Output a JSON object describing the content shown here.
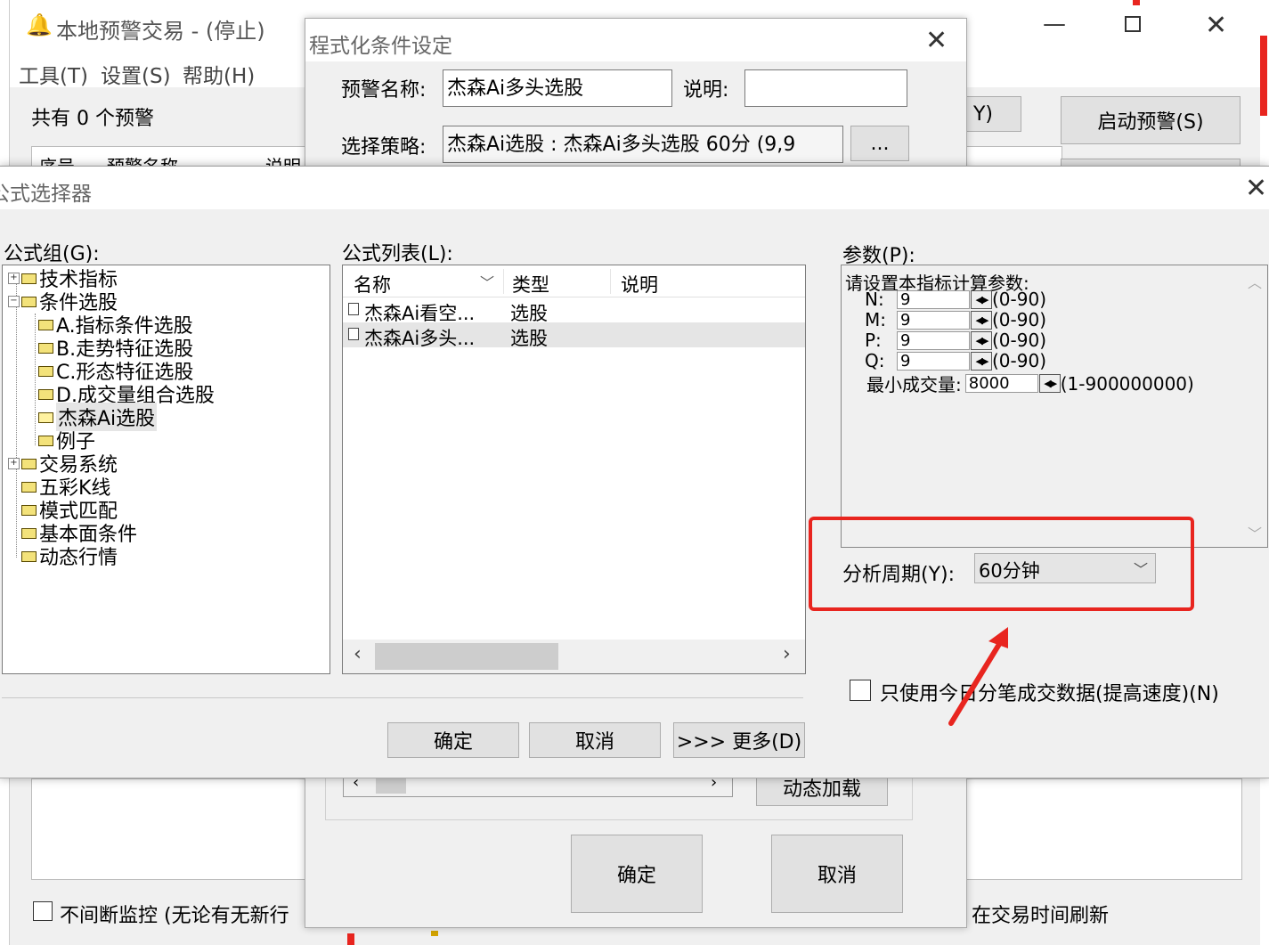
{
  "main_window": {
    "title": "本地预警交易 - (停止)",
    "menu": [
      "工具(T)",
      "设置(S)",
      "帮助(H)"
    ],
    "count_text": "共有 0 个预警",
    "columns": [
      "序号",
      "预警名称",
      "说明"
    ],
    "start_button": "启动预警(S)",
    "partial_button": "Y)",
    "continuous_label": "不间断监控 (无论有无新行",
    "refresh_label": "在交易时间刷新"
  },
  "condition_dialog": {
    "title": "程式化条件设定",
    "name_label": "预警名称:",
    "name_value": "杰森Ai多头选股",
    "desc_label": "说明:",
    "desc_value": "",
    "strategy_label": "选择策略:",
    "strategy_value": "杰森Ai选股 : 杰森Ai多头选股 60分 (9,9",
    "browse_button": "...",
    "dynamic_load": "动态加载",
    "ok": "确定",
    "cancel": "取消"
  },
  "formula_dialog": {
    "title": "公式选择器",
    "group_label": "公式组(G):",
    "list_label": "公式列表(L):",
    "param_label": "参数(P):",
    "tree": [
      {
        "label": "技术指标",
        "level": 0,
        "expander": "+"
      },
      {
        "label": "条件选股",
        "level": 0,
        "expander": "-"
      },
      {
        "label": "A.指标条件选股",
        "level": 1,
        "expander": ""
      },
      {
        "label": "B.走势特征选股",
        "level": 1,
        "expander": ""
      },
      {
        "label": "C.形态特征选股",
        "level": 1,
        "expander": ""
      },
      {
        "label": "D.成交量组合选股",
        "level": 1,
        "expander": ""
      },
      {
        "label": "杰森Ai选股",
        "level": 1,
        "expander": "",
        "selected": true
      },
      {
        "label": "例子",
        "level": 1,
        "expander": ""
      },
      {
        "label": "交易系统",
        "level": 0,
        "expander": "+"
      },
      {
        "label": "五彩K线",
        "level": 0,
        "expander": ""
      },
      {
        "label": "模式匹配",
        "level": 0,
        "expander": ""
      },
      {
        "label": "基本面条件",
        "level": 0,
        "expander": ""
      },
      {
        "label": "动态行情",
        "level": 0,
        "expander": ""
      }
    ],
    "list_columns": [
      "名称",
      "类型",
      "说明"
    ],
    "list_rows": [
      {
        "name": "杰森Ai看空...",
        "type": "选股",
        "desc": ""
      },
      {
        "name": "杰森Ai多头...",
        "type": "选股",
        "desc": "",
        "selected": true
      }
    ],
    "params_heading": "请设置本指标计算参数:",
    "params": [
      {
        "name": "N:",
        "value": "9",
        "range": "(0-90)"
      },
      {
        "name": "M:",
        "value": "9",
        "range": "(0-90)"
      },
      {
        "name": "P:",
        "value": "9",
        "range": "(0-90)"
      },
      {
        "name": "Q:",
        "value": "9",
        "range": "(0-90)"
      }
    ],
    "min_volume_label": "最小成交量:",
    "min_volume_value": "8000",
    "min_volume_range": "(1-900000000)",
    "period_label": "分析周期(Y):",
    "period_value": "60分钟",
    "today_only_label": "只使用今日分笔成交数据(提高速度)(N)",
    "ok": "确定",
    "cancel": "取消",
    "more": ">>> 更多(D)"
  },
  "colors": {
    "highlight_box": "#e8251f",
    "arrow": "#e8251f",
    "dialog_bg": "#f0f0f0"
  }
}
